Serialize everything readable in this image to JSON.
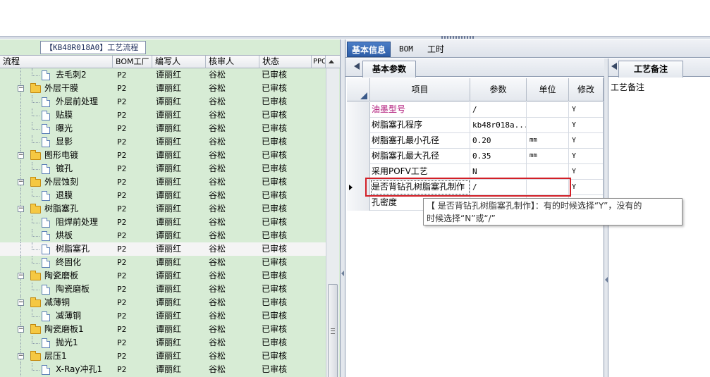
{
  "left_panel": {
    "tab_title": "【KB48R018A0】工艺流程",
    "columns": [
      "流程",
      "BOM工厂",
      "编写人",
      "核审人",
      "状态",
      "PPC"
    ],
    "rows": [
      {
        "name": "去毛刺2",
        "type": "file",
        "depth": 2,
        "factory": "P2",
        "author": "谭丽红",
        "reviewer": "谷松",
        "status": "已审核"
      },
      {
        "name": "外层干膜",
        "type": "folder",
        "depth": 1,
        "factory": "P2",
        "author": "谭丽红",
        "reviewer": "谷松",
        "status": "已审核"
      },
      {
        "name": "外层前处理",
        "type": "file",
        "depth": 2,
        "factory": "P2",
        "author": "谭丽红",
        "reviewer": "谷松",
        "status": "已审核"
      },
      {
        "name": "贴膜",
        "type": "file",
        "depth": 2,
        "factory": "P2",
        "author": "谭丽红",
        "reviewer": "谷松",
        "status": "已审核"
      },
      {
        "name": "曝光",
        "type": "file",
        "depth": 2,
        "factory": "P2",
        "author": "谭丽红",
        "reviewer": "谷松",
        "status": "已审核"
      },
      {
        "name": "显影",
        "type": "file",
        "depth": 2,
        "factory": "P2",
        "author": "谭丽红",
        "reviewer": "谷松",
        "status": "已审核"
      },
      {
        "name": "图形电镀",
        "type": "folder",
        "depth": 1,
        "factory": "P2",
        "author": "谭丽红",
        "reviewer": "谷松",
        "status": "已审核"
      },
      {
        "name": "镀孔",
        "type": "file",
        "depth": 2,
        "factory": "P2",
        "author": "谭丽红",
        "reviewer": "谷松",
        "status": "已审核"
      },
      {
        "name": "外层蚀刻",
        "type": "folder",
        "depth": 1,
        "factory": "P2",
        "author": "谭丽红",
        "reviewer": "谷松",
        "status": "已审核"
      },
      {
        "name": "退膜",
        "type": "file",
        "depth": 2,
        "factory": "P2",
        "author": "谭丽红",
        "reviewer": "谷松",
        "status": "已审核"
      },
      {
        "name": "树脂塞孔",
        "type": "folder",
        "depth": 1,
        "factory": "P2",
        "author": "谭丽红",
        "reviewer": "谷松",
        "status": "已审核"
      },
      {
        "name": "阻焊前处理",
        "type": "file",
        "depth": 2,
        "factory": "P2",
        "author": "谭丽红",
        "reviewer": "谷松",
        "status": "已审核"
      },
      {
        "name": "烘板",
        "type": "file",
        "depth": 2,
        "factory": "P2",
        "author": "谭丽红",
        "reviewer": "谷松",
        "status": "已审核"
      },
      {
        "name": "树脂塞孔",
        "type": "file",
        "depth": 2,
        "factory": "P2",
        "author": "谭丽红",
        "reviewer": "谷松",
        "status": "已审核",
        "selected": true
      },
      {
        "name": "终固化",
        "type": "file",
        "depth": 2,
        "factory": "P2",
        "author": "谭丽红",
        "reviewer": "谷松",
        "status": "已审核"
      },
      {
        "name": "陶瓷磨板",
        "type": "folder",
        "depth": 1,
        "factory": "P2",
        "author": "谭丽红",
        "reviewer": "谷松",
        "status": "已审核"
      },
      {
        "name": "陶瓷磨板",
        "type": "file",
        "depth": 2,
        "factory": "P2",
        "author": "谭丽红",
        "reviewer": "谷松",
        "status": "已审核"
      },
      {
        "name": "减薄铜",
        "type": "folder",
        "depth": 1,
        "factory": "P2",
        "author": "谭丽红",
        "reviewer": "谷松",
        "status": "已审核"
      },
      {
        "name": "减薄铜",
        "type": "file",
        "depth": 2,
        "factory": "P2",
        "author": "谭丽红",
        "reviewer": "谷松",
        "status": "已审核"
      },
      {
        "name": "陶瓷磨板1",
        "type": "folder",
        "depth": 1,
        "factory": "P2",
        "author": "谭丽红",
        "reviewer": "谷松",
        "status": "已审核"
      },
      {
        "name": "抛光1",
        "type": "file",
        "depth": 2,
        "factory": "P2",
        "author": "谭丽红",
        "reviewer": "谷松",
        "status": "已审核"
      },
      {
        "name": "层压1",
        "type": "folder",
        "depth": 1,
        "factory": "P2",
        "author": "谭丽红",
        "reviewer": "谷松",
        "status": "已审核"
      },
      {
        "name": "X-Ray冲孔1",
        "type": "file",
        "depth": 2,
        "factory": "P2",
        "author": "谭丽红",
        "reviewer": "谷松",
        "status": "已审核"
      }
    ]
  },
  "right_tabs": [
    "基本信息",
    "BOM",
    "工时"
  ],
  "params_tab": "基本参数",
  "params_columns": [
    "项目",
    "参数",
    "单位",
    "修改"
  ],
  "params_rows": [
    {
      "item": "油墨型号",
      "value": "/",
      "unit": "",
      "edit": "Y",
      "item_color": "#b0187a"
    },
    {
      "item": "树脂塞孔程序",
      "value": "kb48r018a...",
      "unit": "",
      "edit": "Y"
    },
    {
      "item": "树脂塞孔最小孔径",
      "value": "0.20",
      "unit": "mm",
      "edit": "Y"
    },
    {
      "item": "树脂塞孔最大孔径",
      "value": "0.35",
      "unit": "mm",
      "edit": "Y"
    },
    {
      "item": "采用POFV工艺",
      "value": "N",
      "unit": "",
      "edit": "Y"
    },
    {
      "item": "是否背钻孔树脂塞孔制作",
      "value": "/",
      "unit": "",
      "edit": "Y",
      "current": true
    },
    {
      "item": "孔密度",
      "value": "",
      "unit": "",
      "edit": ""
    }
  ],
  "tooltip": {
    "line1": "【        是否背钻孔树脂塞孔制作】：有的时候选择“Y”，没有的",
    "line2": "时候选择“N”或“/”"
  },
  "remarks": {
    "tab": "工艺备注",
    "label": "工艺备注"
  },
  "colors": {
    "tree_bg": "#d7ecd5",
    "highlight_border": "#d21f27",
    "active_tab": "#2e5ea8"
  }
}
